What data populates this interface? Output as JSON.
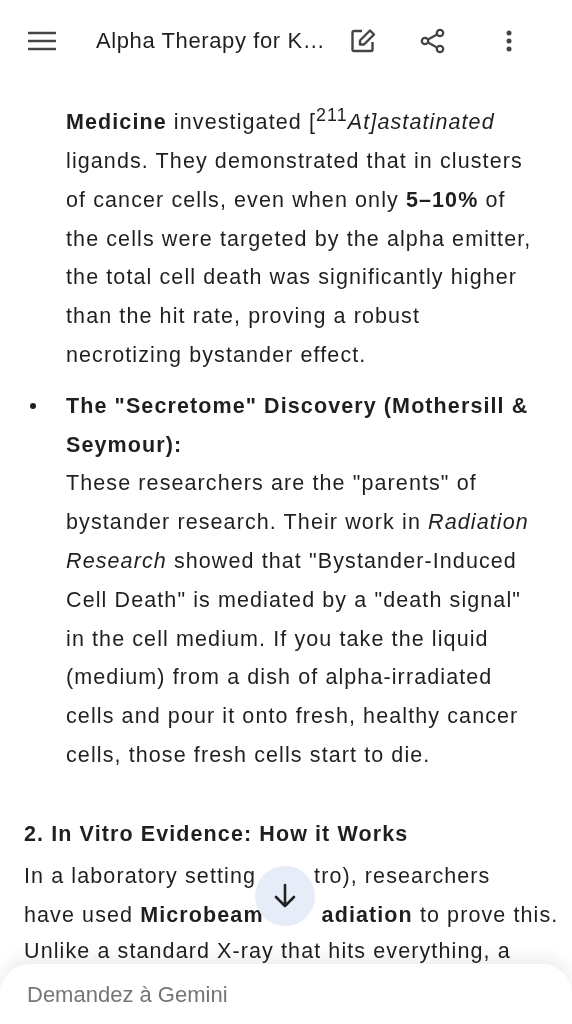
{
  "app_bar": {
    "title": "Alpha Therapy for K…"
  },
  "content": [
    {
      "kind": "continuation",
      "text": "**Medicine** investigated [$^{211}$*At]astatinated* ligands. They demonstrated that in clusters of cancer cells, even when only **5–10%** of the cells were targeted by the alpha emitter, the total cell death was significantly higher than the hit rate, proving a robust necrotizing bystander effect."
    },
    {
      "kind": "bullet",
      "title": "The \"Secretome\" Discovery (Mothersill & Seymour):",
      "text": "These researchers are the \"parents\" of bystander research. Their work in *Radiation Research* showed that \"Bystander-Induced Cell Death\" is mediated by a \"death signal\" in the cell medium. If you take the liquid (medium) from a dish of alpha-irradiated cells and pour it onto fresh, healthy cancer cells, those fresh cells start to die."
    },
    {
      "kind": "heading",
      "text": "2. In Vitro Evidence: How it Works"
    },
    {
      "kind": "covered_paragraph",
      "lines": [
        [
          "In a laboratory setting",
          "tro), researchers"
        ],
        [
          "have used **Microbeam**",
          "**adiation** to prove this."
        ]
      ]
    },
    {
      "kind": "cut_line",
      "text": "Unlike a standard X-ray that hits everything, a"
    }
  ],
  "input": {
    "placeholder": "Demandez à Gemini"
  }
}
